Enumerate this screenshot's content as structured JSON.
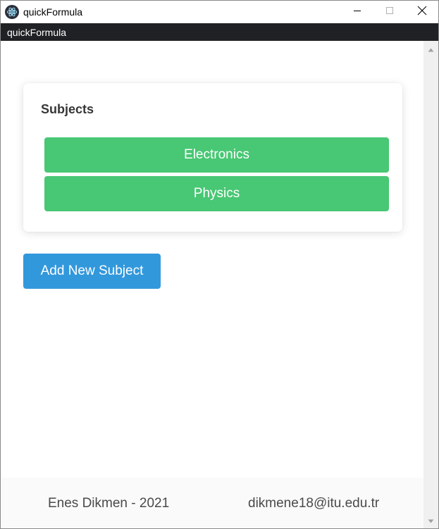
{
  "window": {
    "title": "quickFormula",
    "menu_title": "quickFormula"
  },
  "card": {
    "title": "Subjects",
    "subjects": [
      "Electronics",
      "Physics"
    ]
  },
  "actions": {
    "add_label": "Add New Subject"
  },
  "footer": {
    "author": "Enes Dikmen - 2021",
    "email": "dikmene18@itu.edu.tr"
  },
  "colors": {
    "subject_button": "#48c774",
    "add_button": "#3298dc",
    "menubar": "#202124"
  },
  "icons": {
    "app": "electron-app-icon",
    "minimize": "minimize-icon",
    "maximize": "maximize-icon",
    "close": "close-icon",
    "scroll_up": "scroll-up-arrow-icon",
    "scroll_down": "scroll-down-arrow-icon"
  }
}
